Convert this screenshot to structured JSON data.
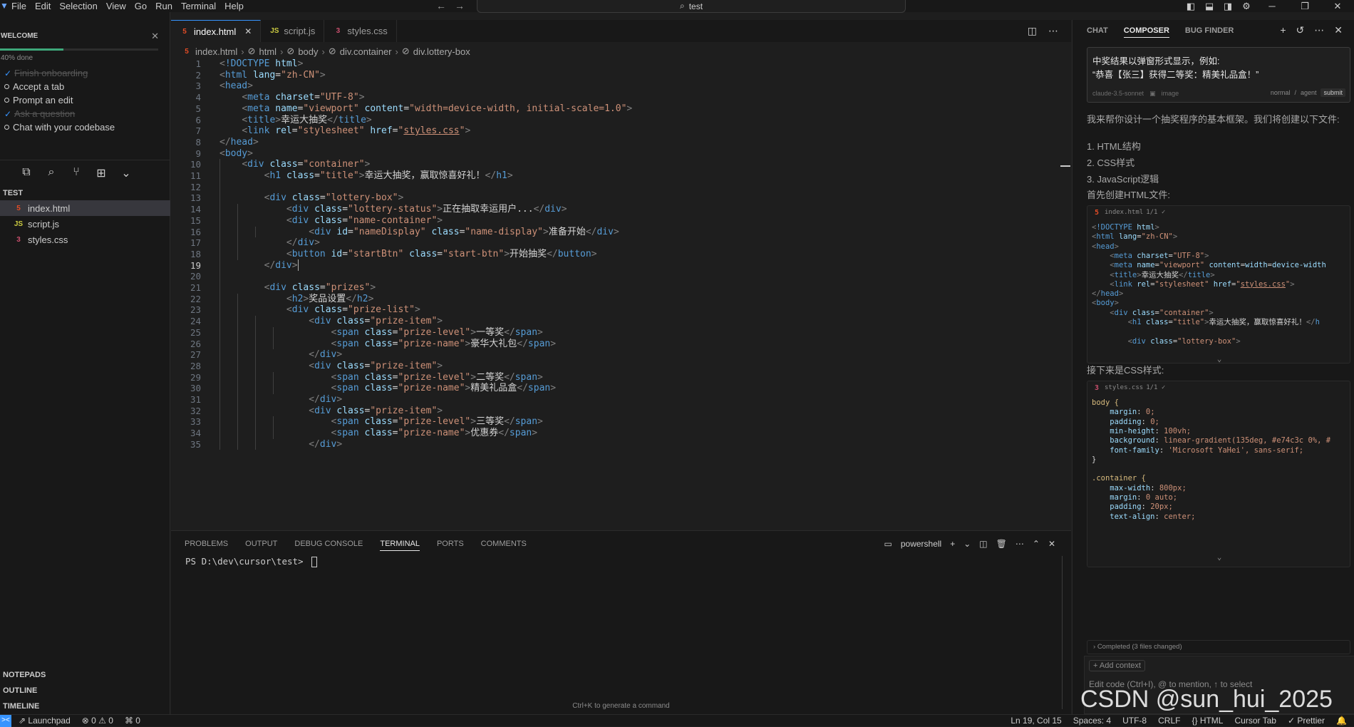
{
  "menu": [
    "File",
    "Edit",
    "Selection",
    "View",
    "Go",
    "Run",
    "Terminal",
    "Help"
  ],
  "search": {
    "label": "test"
  },
  "welcome": {
    "title": "WELCOME",
    "progress_text": "40% done",
    "progress": 0.4,
    "items": [
      {
        "label": "Finish onboarding",
        "done": true
      },
      {
        "label": "Accept a tab",
        "done": false
      },
      {
        "label": "Prompt an edit",
        "done": false
      },
      {
        "label": "Ask a question",
        "done": true
      },
      {
        "label": "Chat with your codebase",
        "done": false
      }
    ]
  },
  "explorer": {
    "title": "TEST",
    "files": [
      {
        "icon": "html-file-icon",
        "label": "index.html",
        "type": "html",
        "badge": "5",
        "active": true
      },
      {
        "icon": "js-file-icon",
        "label": "script.js",
        "type": "js",
        "badge": "JS",
        "active": false
      },
      {
        "icon": "css-file-icon",
        "label": "styles.css",
        "type": "css",
        "badge": "3",
        "active": false
      }
    ]
  },
  "sidebar_sections": [
    "NOTEPADS",
    "OUTLINE",
    "TIMELINE"
  ],
  "tabs": [
    {
      "label": "index.html",
      "badge": "5",
      "type": "html",
      "active": true
    },
    {
      "label": "script.js",
      "badge": "JS",
      "type": "js",
      "active": false
    },
    {
      "label": "styles.css",
      "badge": "3",
      "type": "css",
      "active": false
    }
  ],
  "breadcrumb": [
    "index.html",
    "html",
    "body",
    "div.container",
    "div.lottery-box"
  ],
  "code_lines": [
    "<!DOCTYPE html>",
    "<html lang=\"zh-CN\">",
    "<head>",
    "    <meta charset=\"UTF-8\">",
    "    <meta name=\"viewport\" content=\"width=device-width, initial-scale=1.0\">",
    "    <title>幸运大抽奖</title>",
    "    <link rel=\"stylesheet\" href=\"styles.css\">",
    "</head>",
    "<body>",
    "    <div class=\"container\">",
    "        <h1 class=\"title\">幸运大抽奖，赢取惊喜好礼！</h1>",
    "",
    "        <div class=\"lottery-box\">",
    "            <div class=\"lottery-status\">正在抽取幸运用户...</div>",
    "            <div class=\"name-container\">",
    "                <div id=\"nameDisplay\" class=\"name-display\">准备开始</div>",
    "            </div>",
    "            <button id=\"startBtn\" class=\"start-btn\">开始抽奖</button>",
    "        </div>",
    "",
    "        <div class=\"prizes\">",
    "            <h2>奖品设置</h2>",
    "            <div class=\"prize-list\">",
    "                <div class=\"prize-item\">",
    "                    <span class=\"prize-level\">一等奖</span>",
    "                    <span class=\"prize-name\">豪华大礼包</span>",
    "                </div>",
    "                <div class=\"prize-item\">",
    "                    <span class=\"prize-level\">二等奖</span>",
    "                    <span class=\"prize-name\">精美礼品盒</span>",
    "                </div>",
    "                <div class=\"prize-item\">",
    "                    <span class=\"prize-level\">三等奖</span>",
    "                    <span class=\"prize-name\">优惠券</span>",
    "                </div>"
  ],
  "current_line": 19,
  "panel": {
    "tabs": [
      "PROBLEMS",
      "OUTPUT",
      "DEBUG CONSOLE",
      "TERMINAL",
      "PORTS",
      "COMMENTS"
    ],
    "active_tab": "TERMINAL",
    "shell": "powershell",
    "prompt": "PS D:\\dev\\cursor\\test> ",
    "hint": "Ctrl+K to generate a command"
  },
  "chat": {
    "tabs": [
      "CHAT",
      "COMPOSER",
      "BUG FINDER"
    ],
    "active_tab": "COMPOSER",
    "request_lines": [
      "中奖结果以弹窗形式显示，例如:",
      "“恭喜【张三】获得二等奖：精美礼品盒！”"
    ],
    "model": "claude-3.5-sonnet",
    "image_label": "image",
    "mode_normal": "normal",
    "mode_agent": "agent",
    "submit": "submit",
    "intro": "我来帮你设计一个抽奖程序的基本框架。我们将创建以下文件:",
    "steps": [
      "1. HTML结构",
      "2. CSS样式",
      "3. JavaScript逻辑"
    ],
    "html_heading": "首先创建HTML文件:",
    "html_card": {
      "file": "index.html",
      "status": "1/1 ✓",
      "lines": [
        "<!DOCTYPE html>",
        "<html lang=\"zh-CN\">",
        "<head>",
        "    <meta charset=\"UTF-8\">",
        "    <meta name=\"viewport\" content=\"width=device-width",
        "    <title>幸运大抽奖</title>",
        "    <link rel=\"stylesheet\" href=\"styles.css\">",
        "</head>",
        "<body>",
        "    <div class=\"container\">",
        "        <h1 class=\"title\">幸运大抽奖，赢取惊喜好礼！</h",
        "",
        "        <div class=\"lottery-box\">"
      ]
    },
    "css_heading": "接下来是CSS样式:",
    "css_card": {
      "file": "styles.css",
      "status": "1/1 ✓",
      "lines": [
        "body {",
        "    margin: 0;",
        "    padding: 0;",
        "    min-height: 100vh;",
        "    background: linear-gradient(135deg, #e74c3c 0%, #",
        "    font-family: 'Microsoft YaHei', sans-serif;",
        "}",
        "",
        ".container {",
        "    max-width: 800px;",
        "    margin: 0 auto;",
        "    padding: 20px;",
        "    text-align: center;"
      ]
    },
    "completed": "Completed (3 files changed)",
    "add_context": "+ Add context",
    "placeholder": "Edit code (Ctrl+I), @ to mention, ↑ to select"
  },
  "watermark": "CSDN @sun_hui_2025",
  "status": {
    "launchpad": "Launchpad",
    "problems": "⊗ 0 ⚠ 0",
    "ports": "⌘ 0",
    "position": "Ln 19, Col 15",
    "spaces": "Spaces: 4",
    "encoding": "UTF-8",
    "eol": "CRLF",
    "language": "HTML",
    "cursor_tab": "Cursor Tab",
    "prettier": "✓ Prettier"
  },
  "colors": {
    "accent": "#3794ff",
    "progress": "#3ea87a",
    "background": "#1e1e1e",
    "sidebar": "#181818"
  }
}
